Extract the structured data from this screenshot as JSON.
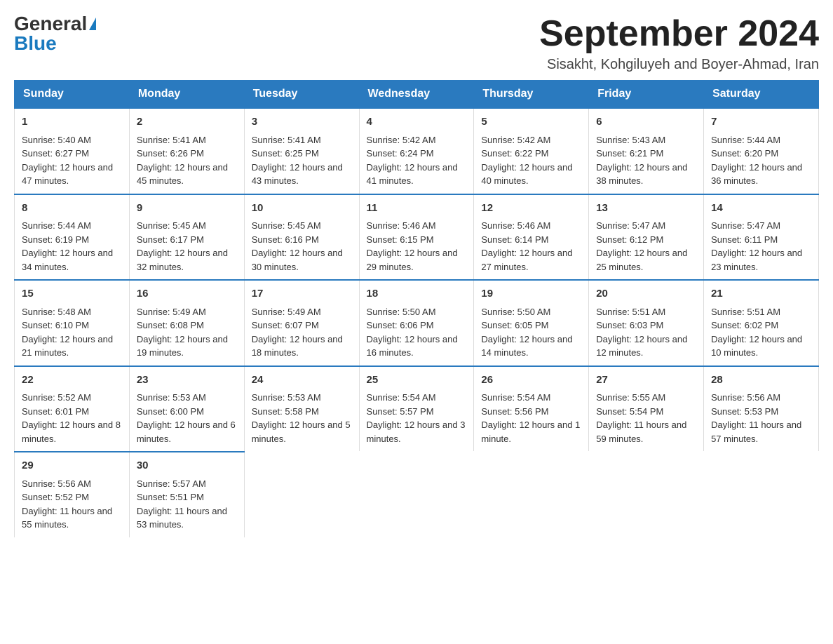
{
  "logo": {
    "general": "General",
    "blue": "Blue"
  },
  "title": "September 2024",
  "subtitle": "Sisakht, Kohgiluyeh and Boyer-Ahmad, Iran",
  "headers": [
    "Sunday",
    "Monday",
    "Tuesday",
    "Wednesday",
    "Thursday",
    "Friday",
    "Saturday"
  ],
  "weeks": [
    [
      {
        "day": "1",
        "sunrise": "5:40 AM",
        "sunset": "6:27 PM",
        "daylight": "12 hours and 47 minutes."
      },
      {
        "day": "2",
        "sunrise": "5:41 AM",
        "sunset": "6:26 PM",
        "daylight": "12 hours and 45 minutes."
      },
      {
        "day": "3",
        "sunrise": "5:41 AM",
        "sunset": "6:25 PM",
        "daylight": "12 hours and 43 minutes."
      },
      {
        "day": "4",
        "sunrise": "5:42 AM",
        "sunset": "6:24 PM",
        "daylight": "12 hours and 41 minutes."
      },
      {
        "day": "5",
        "sunrise": "5:42 AM",
        "sunset": "6:22 PM",
        "daylight": "12 hours and 40 minutes."
      },
      {
        "day": "6",
        "sunrise": "5:43 AM",
        "sunset": "6:21 PM",
        "daylight": "12 hours and 38 minutes."
      },
      {
        "day": "7",
        "sunrise": "5:44 AM",
        "sunset": "6:20 PM",
        "daylight": "12 hours and 36 minutes."
      }
    ],
    [
      {
        "day": "8",
        "sunrise": "5:44 AM",
        "sunset": "6:19 PM",
        "daylight": "12 hours and 34 minutes."
      },
      {
        "day": "9",
        "sunrise": "5:45 AM",
        "sunset": "6:17 PM",
        "daylight": "12 hours and 32 minutes."
      },
      {
        "day": "10",
        "sunrise": "5:45 AM",
        "sunset": "6:16 PM",
        "daylight": "12 hours and 30 minutes."
      },
      {
        "day": "11",
        "sunrise": "5:46 AM",
        "sunset": "6:15 PM",
        "daylight": "12 hours and 29 minutes."
      },
      {
        "day": "12",
        "sunrise": "5:46 AM",
        "sunset": "6:14 PM",
        "daylight": "12 hours and 27 minutes."
      },
      {
        "day": "13",
        "sunrise": "5:47 AM",
        "sunset": "6:12 PM",
        "daylight": "12 hours and 25 minutes."
      },
      {
        "day": "14",
        "sunrise": "5:47 AM",
        "sunset": "6:11 PM",
        "daylight": "12 hours and 23 minutes."
      }
    ],
    [
      {
        "day": "15",
        "sunrise": "5:48 AM",
        "sunset": "6:10 PM",
        "daylight": "12 hours and 21 minutes."
      },
      {
        "day": "16",
        "sunrise": "5:49 AM",
        "sunset": "6:08 PM",
        "daylight": "12 hours and 19 minutes."
      },
      {
        "day": "17",
        "sunrise": "5:49 AM",
        "sunset": "6:07 PM",
        "daylight": "12 hours and 18 minutes."
      },
      {
        "day": "18",
        "sunrise": "5:50 AM",
        "sunset": "6:06 PM",
        "daylight": "12 hours and 16 minutes."
      },
      {
        "day": "19",
        "sunrise": "5:50 AM",
        "sunset": "6:05 PM",
        "daylight": "12 hours and 14 minutes."
      },
      {
        "day": "20",
        "sunrise": "5:51 AM",
        "sunset": "6:03 PM",
        "daylight": "12 hours and 12 minutes."
      },
      {
        "day": "21",
        "sunrise": "5:51 AM",
        "sunset": "6:02 PM",
        "daylight": "12 hours and 10 minutes."
      }
    ],
    [
      {
        "day": "22",
        "sunrise": "5:52 AM",
        "sunset": "6:01 PM",
        "daylight": "12 hours and 8 minutes."
      },
      {
        "day": "23",
        "sunrise": "5:53 AM",
        "sunset": "6:00 PM",
        "daylight": "12 hours and 6 minutes."
      },
      {
        "day": "24",
        "sunrise": "5:53 AM",
        "sunset": "5:58 PM",
        "daylight": "12 hours and 5 minutes."
      },
      {
        "day": "25",
        "sunrise": "5:54 AM",
        "sunset": "5:57 PM",
        "daylight": "12 hours and 3 minutes."
      },
      {
        "day": "26",
        "sunrise": "5:54 AM",
        "sunset": "5:56 PM",
        "daylight": "12 hours and 1 minute."
      },
      {
        "day": "27",
        "sunrise": "5:55 AM",
        "sunset": "5:54 PM",
        "daylight": "11 hours and 59 minutes."
      },
      {
        "day": "28",
        "sunrise": "5:56 AM",
        "sunset": "5:53 PM",
        "daylight": "11 hours and 57 minutes."
      }
    ],
    [
      {
        "day": "29",
        "sunrise": "5:56 AM",
        "sunset": "5:52 PM",
        "daylight": "11 hours and 55 minutes."
      },
      {
        "day": "30",
        "sunrise": "5:57 AM",
        "sunset": "5:51 PM",
        "daylight": "11 hours and 53 minutes."
      },
      null,
      null,
      null,
      null,
      null
    ]
  ]
}
